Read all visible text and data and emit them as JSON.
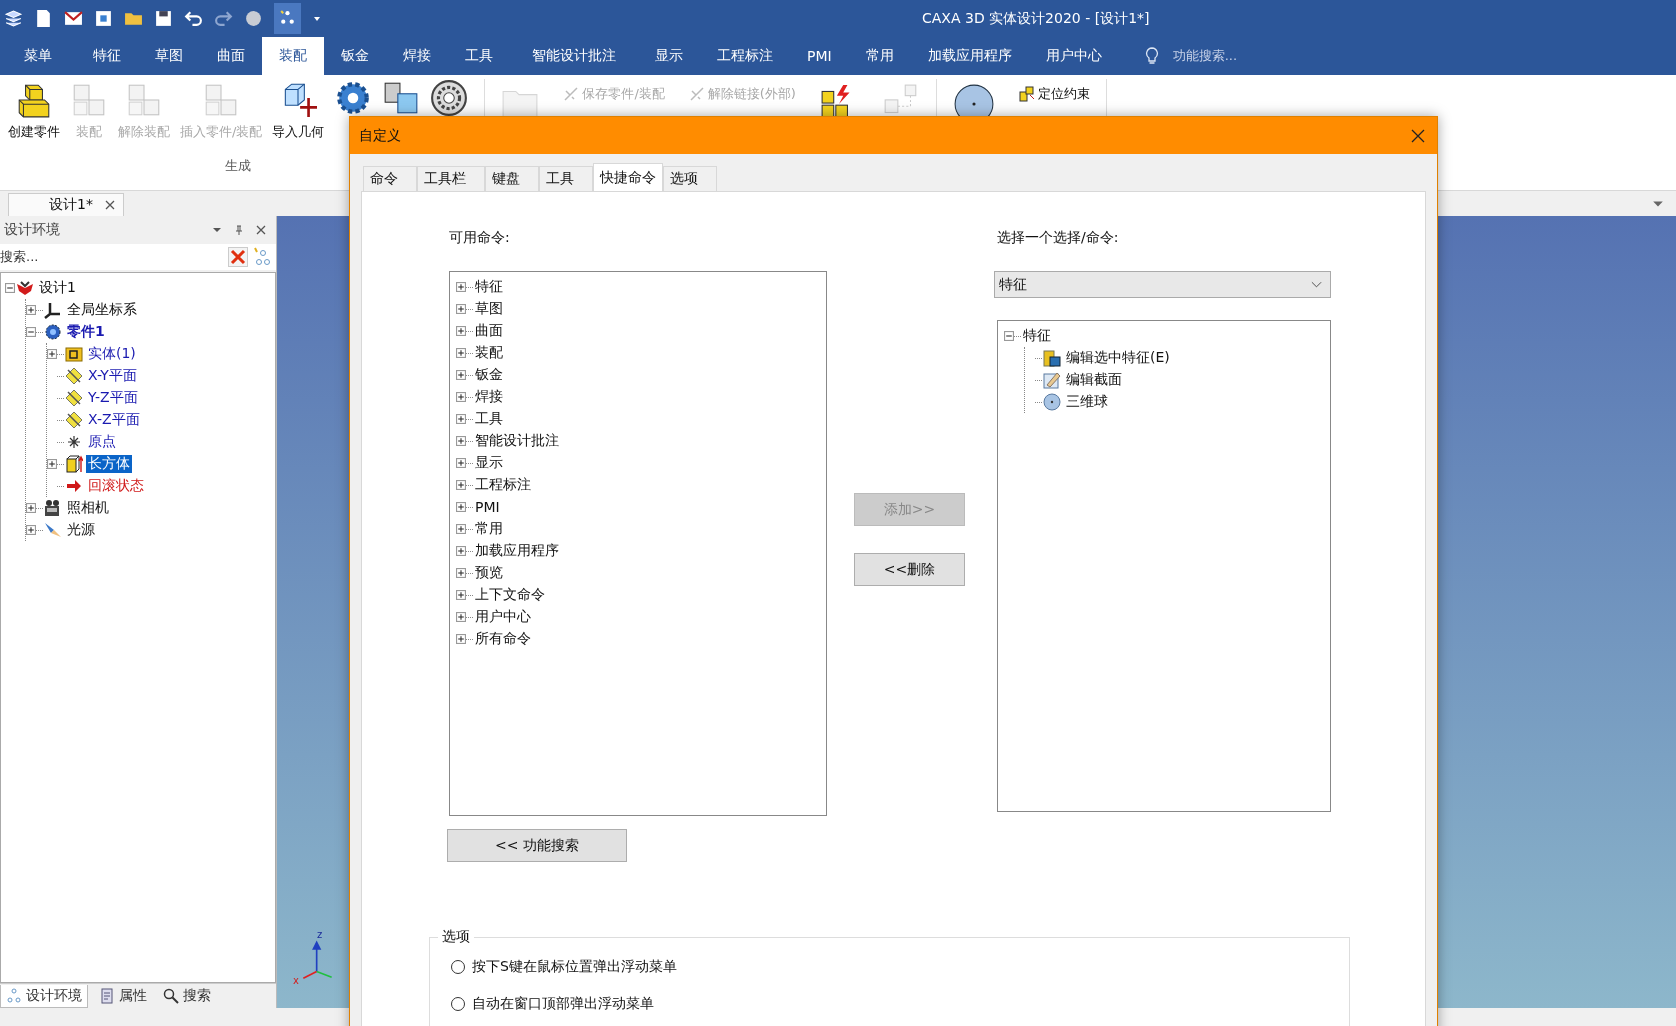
{
  "app": {
    "title": "CAXA 3D 实体设计2020 - [设计1*]"
  },
  "ribbon_tabs": [
    {
      "label": "菜单",
      "selected": false
    },
    {
      "label": "特征",
      "selected": false
    },
    {
      "label": "草图",
      "selected": false
    },
    {
      "label": "曲面",
      "selected": false
    },
    {
      "label": "装配",
      "selected": true
    },
    {
      "label": "钣金",
      "selected": false
    },
    {
      "label": "焊接",
      "selected": false
    },
    {
      "label": "工具",
      "selected": false
    },
    {
      "label": "智能设计批注",
      "selected": false
    },
    {
      "label": "显示",
      "selected": false
    },
    {
      "label": "工程标注",
      "selected": false
    },
    {
      "label": "PMI",
      "selected": false
    },
    {
      "label": "常用",
      "selected": false
    },
    {
      "label": "加载应用程序",
      "selected": false
    },
    {
      "label": "用户中心",
      "selected": false
    }
  ],
  "feature_search": {
    "placeholder": "功能搜索..."
  },
  "ribbon": {
    "large_buttons": [
      {
        "label": "创建零件",
        "kind": "part",
        "disabled": false
      },
      {
        "label": "装配",
        "kind": "assembly",
        "disabled": true
      },
      {
        "label": "解除装配",
        "kind": "disassemble",
        "disabled": true
      },
      {
        "label": "插入零件/装配",
        "kind": "insert",
        "disabled": true
      },
      {
        "label": "导入几何",
        "kind": "import",
        "disabled": false
      },
      {
        "kind": "gear",
        "disabled": false
      },
      {
        "kind": "copy",
        "disabled": false
      },
      {
        "kind": "bearing",
        "disabled": false
      }
    ],
    "group_label": "生成",
    "small_buttons": [
      {
        "label": "保存零件/装配",
        "disabled": true
      },
      {
        "label": "解除链接(外部)",
        "disabled": true
      }
    ],
    "constraint_button": {
      "label": "定位约束"
    }
  },
  "document_tab": {
    "label": "设计1*"
  },
  "panel": {
    "title": "设计环境",
    "search_placeholder": "搜索...",
    "tree": [
      {
        "label": "设计1",
        "kind": "design",
        "active": false,
        "selected": false,
        "expanded": true,
        "children": [
          {
            "label": "全局坐标系",
            "kind": "axes",
            "active": false,
            "selected": false,
            "expanded": false
          },
          {
            "label": "零件1",
            "kind": "partgear",
            "color": "#1a1ab0",
            "active": true,
            "selected": false,
            "expanded": true,
            "children": [
              {
                "label": "实体(1)",
                "kind": "folder",
                "color": "#1a1ab0",
                "active": false,
                "selected": false,
                "expanded": false
              },
              {
                "label": "X-Y平面",
                "kind": "plane",
                "color": "#1a1ab0",
                "active": false,
                "selected": false
              },
              {
                "label": "Y-Z平面",
                "kind": "plane",
                "color": "#1a1ab0",
                "active": false,
                "selected": false
              },
              {
                "label": "X-Z平面",
                "kind": "plane",
                "color": "#1a1ab0",
                "active": false,
                "selected": false
              },
              {
                "label": "原点",
                "kind": "origin",
                "color": "#1a1ab0",
                "active": false,
                "selected": false
              },
              {
                "label": "长方体",
                "kind": "block",
                "active": false,
                "selected": true,
                "expanded": false
              },
              {
                "label": "回滚状态",
                "kind": "rollback",
                "color": "#d01818",
                "active": false,
                "selected": false
              }
            ]
          },
          {
            "label": "照相机",
            "kind": "camera",
            "active": false,
            "selected": false,
            "expanded": false
          },
          {
            "label": "光源",
            "kind": "light",
            "active": false,
            "selected": false,
            "expanded": false
          }
        ]
      }
    ],
    "bottom_tabs": [
      {
        "label": "设计环境",
        "kind": "tree",
        "selected": true
      },
      {
        "label": "属性",
        "kind": "props",
        "selected": false
      },
      {
        "label": "搜索",
        "kind": "search",
        "selected": false
      }
    ]
  },
  "dialog": {
    "title": "自定义",
    "tabs": [
      {
        "label": "命令",
        "selected": false
      },
      {
        "label": "工具栏",
        "selected": false
      },
      {
        "label": "键盘",
        "selected": false
      },
      {
        "label": "工具",
        "selected": false
      },
      {
        "label": "快捷命令",
        "selected": true
      },
      {
        "label": "选项",
        "selected": false
      }
    ],
    "available_label": "可用命令:",
    "commands": [
      {
        "label": "特征",
        "expanded": false
      },
      {
        "label": "草图",
        "expanded": false
      },
      {
        "label": "曲面",
        "expanded": false
      },
      {
        "label": "装配",
        "expanded": false
      },
      {
        "label": "钣金",
        "expanded": false
      },
      {
        "label": "焊接",
        "expanded": false
      },
      {
        "label": "工具",
        "expanded": false
      },
      {
        "label": "智能设计批注",
        "expanded": false
      },
      {
        "label": "显示",
        "expanded": false
      },
      {
        "label": "工程标注",
        "expanded": false
      },
      {
        "label": "PMI",
        "expanded": false
      },
      {
        "label": "常用",
        "expanded": false
      },
      {
        "label": "加载应用程序",
        "expanded": false
      },
      {
        "label": "预览",
        "expanded": false
      },
      {
        "label": "上下文命令",
        "expanded": false
      },
      {
        "label": "用户中心",
        "expanded": false
      },
      {
        "label": "所有命令",
        "expanded": false
      }
    ],
    "search_button": "<< 功能搜索",
    "add_button": {
      "label": "添加>>",
      "disabled": true
    },
    "remove_button": {
      "label": "<<删除",
      "disabled": false
    },
    "select_label": "选择一个选择/命令:",
    "select_value": "特征",
    "assigned": [
      {
        "label": "特征",
        "expanded": true,
        "children": [
          {
            "label": "编辑选中特征(E)",
            "kind": "editfeature"
          },
          {
            "label": "编辑截面",
            "kind": "editsection"
          },
          {
            "label": "三维球",
            "kind": "ball"
          }
        ]
      }
    ],
    "options": {
      "title": "选项",
      "items": [
        {
          "label": "按下S键在鼠标位置弹出浮动菜单",
          "selected": false
        },
        {
          "label": "自动在窗口顶部弹出浮动菜单",
          "selected": false
        }
      ]
    }
  },
  "viewport": {
    "axis_labels": [
      "z",
      "x"
    ]
  }
}
